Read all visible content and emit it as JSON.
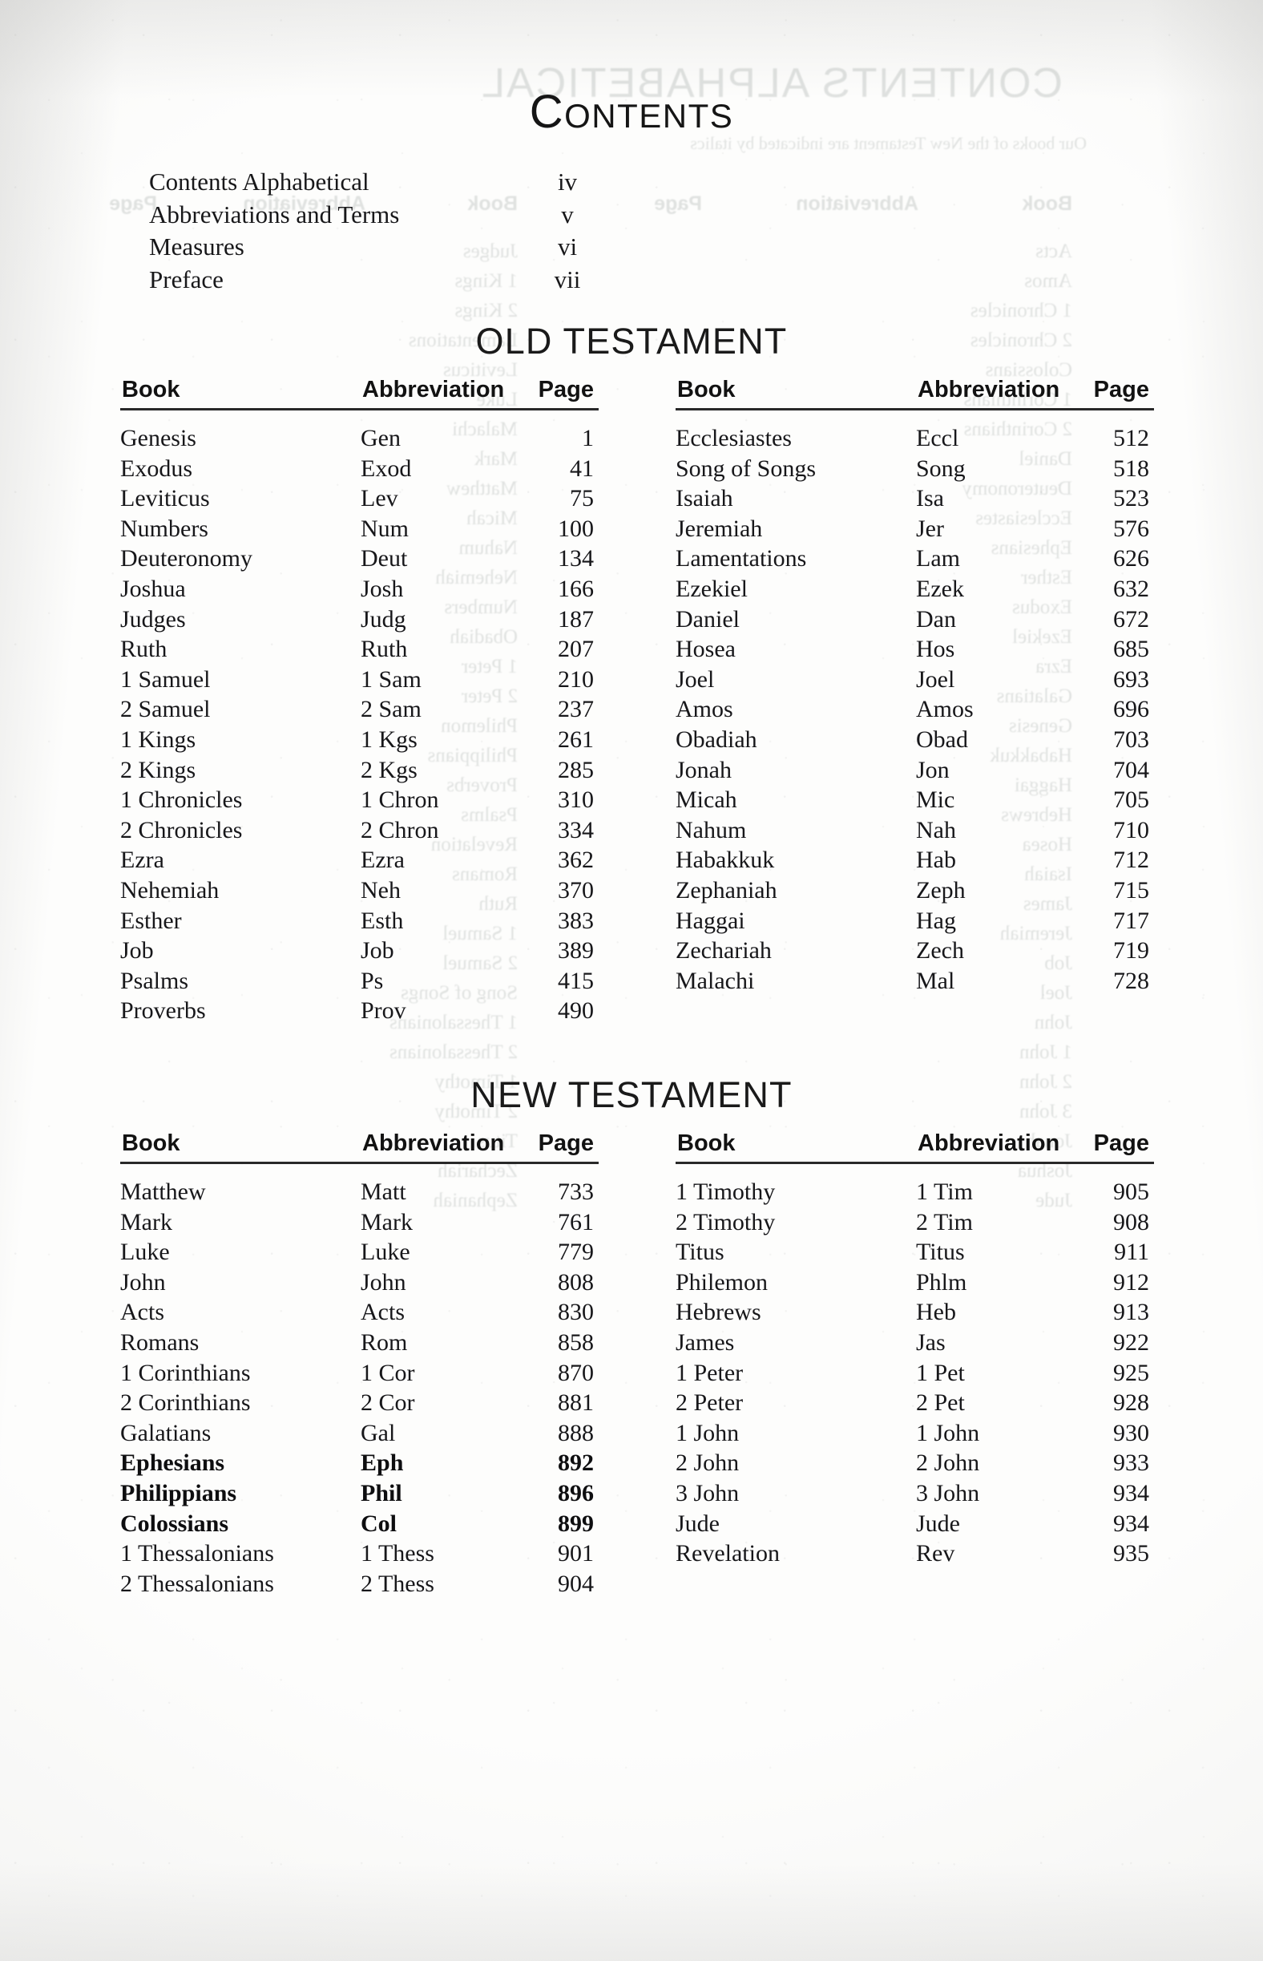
{
  "page": {
    "title": "Contents",
    "title_first_letter": "C",
    "title_rest": "ONTENTS"
  },
  "front_matter": {
    "rows": [
      {
        "label": "Contents Alphabetical",
        "page": "iv"
      },
      {
        "label": "Abbreviations and Terms",
        "page": "v"
      },
      {
        "label": "Measures",
        "page": "vi"
      },
      {
        "label": "Preface",
        "page": "vii"
      }
    ]
  },
  "old_testament": {
    "heading": "OLD TESTAMENT",
    "columns": {
      "book": "Book",
      "abbreviation": "Abbreviation",
      "page": "Page"
    },
    "left": [
      {
        "book": "Genesis",
        "abbr": "Gen",
        "page": "1"
      },
      {
        "book": "Exodus",
        "abbr": "Exod",
        "page": "41"
      },
      {
        "book": "Leviticus",
        "abbr": "Lev",
        "page": "75"
      },
      {
        "book": "Numbers",
        "abbr": "Num",
        "page": "100"
      },
      {
        "book": "Deuteronomy",
        "abbr": "Deut",
        "page": "134"
      },
      {
        "book": "Joshua",
        "abbr": "Josh",
        "page": "166"
      },
      {
        "book": "Judges",
        "abbr": "Judg",
        "page": "187"
      },
      {
        "book": "Ruth",
        "abbr": "Ruth",
        "page": "207"
      },
      {
        "book": "1 Samuel",
        "abbr": "1 Sam",
        "page": "210"
      },
      {
        "book": "2 Samuel",
        "abbr": "2 Sam",
        "page": "237"
      },
      {
        "book": "1 Kings",
        "abbr": "1 Kgs",
        "page": "261"
      },
      {
        "book": "2 Kings",
        "abbr": "2 Kgs",
        "page": "285"
      },
      {
        "book": "1 Chronicles",
        "abbr": "1 Chron",
        "page": "310"
      },
      {
        "book": "2 Chronicles",
        "abbr": "2 Chron",
        "page": "334"
      },
      {
        "book": "Ezra",
        "abbr": "Ezra",
        "page": "362"
      },
      {
        "book": "Nehemiah",
        "abbr": "Neh",
        "page": "370"
      },
      {
        "book": "Esther",
        "abbr": "Esth",
        "page": "383"
      },
      {
        "book": "Job",
        "abbr": "Job",
        "page": "389"
      },
      {
        "book": "Psalms",
        "abbr": "Ps",
        "page": "415"
      },
      {
        "book": "Proverbs",
        "abbr": "Prov",
        "page": "490"
      }
    ],
    "right": [
      {
        "book": "Ecclesiastes",
        "abbr": "Eccl",
        "page": "512"
      },
      {
        "book": "Song of Songs",
        "abbr": "Song",
        "page": "518"
      },
      {
        "book": "Isaiah",
        "abbr": "Isa",
        "page": "523"
      },
      {
        "book": "Jeremiah",
        "abbr": "Jer",
        "page": "576"
      },
      {
        "book": "Lamentations",
        "abbr": "Lam",
        "page": "626"
      },
      {
        "book": "Ezekiel",
        "abbr": "Ezek",
        "page": "632"
      },
      {
        "book": "Daniel",
        "abbr": "Dan",
        "page": "672"
      },
      {
        "book": "Hosea",
        "abbr": "Hos",
        "page": "685"
      },
      {
        "book": "Joel",
        "abbr": "Joel",
        "page": "693"
      },
      {
        "book": "Amos",
        "abbr": "Amos",
        "page": "696"
      },
      {
        "book": "Obadiah",
        "abbr": "Obad",
        "page": "703"
      },
      {
        "book": "Jonah",
        "abbr": "Jon",
        "page": "704"
      },
      {
        "book": "Micah",
        "abbr": "Mic",
        "page": "705"
      },
      {
        "book": "Nahum",
        "abbr": "Nah",
        "page": "710"
      },
      {
        "book": "Habakkuk",
        "abbr": "Hab",
        "page": "712"
      },
      {
        "book": "Zephaniah",
        "abbr": "Zeph",
        "page": "715"
      },
      {
        "book": "Haggai",
        "abbr": "Hag",
        "page": "717"
      },
      {
        "book": "Zechariah",
        "abbr": "Zech",
        "page": "719"
      },
      {
        "book": "Malachi",
        "abbr": "Mal",
        "page": "728"
      }
    ]
  },
  "new_testament": {
    "heading": "NEW TESTAMENT",
    "columns": {
      "book": "Book",
      "abbreviation": "Abbreviation",
      "page": "Page"
    },
    "left": [
      {
        "book": "Matthew",
        "abbr": "Matt",
        "page": "733"
      },
      {
        "book": "Mark",
        "abbr": "Mark",
        "page": "761"
      },
      {
        "book": "Luke",
        "abbr": "Luke",
        "page": "779"
      },
      {
        "book": "John",
        "abbr": "John",
        "page": "808"
      },
      {
        "book": "Acts",
        "abbr": "Acts",
        "page": "830"
      },
      {
        "book": "Romans",
        "abbr": "Rom",
        "page": "858"
      },
      {
        "book": "1 Corinthians",
        "abbr": "1 Cor",
        "page": "870"
      },
      {
        "book": "2 Corinthians",
        "abbr": "2 Cor",
        "page": "881"
      },
      {
        "book": "Galatians",
        "abbr": "Gal",
        "page": "888"
      },
      {
        "book": "Ephesians",
        "abbr": "Eph",
        "page": "892"
      },
      {
        "book": "Philippians",
        "abbr": "Phil",
        "page": "896"
      },
      {
        "book": "Colossians",
        "abbr": "Col",
        "page": "899"
      },
      {
        "book": "1 Thessalonians",
        "abbr": "1 Thess",
        "page": "901"
      },
      {
        "book": "2 Thessalonians",
        "abbr": "2 Thess",
        "page": "904"
      }
    ],
    "right": [
      {
        "book": "1 Timothy",
        "abbr": "1 Tim",
        "page": "905"
      },
      {
        "book": "2 Timothy",
        "abbr": "2 Tim",
        "page": "908"
      },
      {
        "book": "Titus",
        "abbr": "Titus",
        "page": "911"
      },
      {
        "book": "Philemon",
        "abbr": "Phlm",
        "page": "912"
      },
      {
        "book": "Hebrews",
        "abbr": "Heb",
        "page": "913"
      },
      {
        "book": "James",
        "abbr": "Jas",
        "page": "922"
      },
      {
        "book": "1 Peter",
        "abbr": "1 Pet",
        "page": "925"
      },
      {
        "book": "2 Peter",
        "abbr": "2 Pet",
        "page": "928"
      },
      {
        "book": "1 John",
        "abbr": "1 John",
        "page": "930"
      },
      {
        "book": "2 John",
        "abbr": "2 John",
        "page": "933"
      },
      {
        "book": "3 John",
        "abbr": "3 John",
        "page": "934"
      },
      {
        "book": "Jude",
        "abbr": "Jude",
        "page": "934"
      },
      {
        "book": "Revelation",
        "abbr": "Rev",
        "page": "935"
      }
    ]
  },
  "bleed_through": {
    "note": "mirrored show-through from the reverse leaf (Contents Alphabetical page)",
    "title": "CONTENTS ALPHABETICAL",
    "intro": "Our books of the New Testament are indicated by italics",
    "headings": [
      "Book",
      "Abbreviation",
      "Page"
    ],
    "rows": [
      "Acts",
      "Amos",
      "1 Chronicles",
      "2 Chronicles",
      "Colossians",
      "1 Corinthians",
      "2 Corinthians",
      "Daniel",
      "Deuteronomy",
      "Ecclesiastes",
      "Ephesians",
      "Esther",
      "Exodus",
      "Ezekiel",
      "Ezra",
      "Galatians",
      "Genesis",
      "Habakkuk",
      "Haggai",
      "Hebrews",
      "Hosea",
      "Isaiah",
      "James",
      "Jeremiah",
      "Job",
      "Joel",
      "John",
      "1 John",
      "2 John",
      "3 John",
      "Jonah",
      "Joshua",
      "Jude",
      "Judges",
      "1 Kings",
      "2 Kings",
      "Lamentations",
      "Leviticus",
      "Luke",
      "Malachi",
      "Mark",
      "Matthew",
      "Micah",
      "Nahum",
      "Nehemiah",
      "Numbers",
      "Obadiah",
      "1 Peter",
      "2 Peter",
      "Philemon",
      "Philippians",
      "Proverbs",
      "Psalms",
      "Revelation",
      "Romans",
      "Ruth",
      "1 Samuel",
      "2 Samuel",
      "Song of Songs",
      "1 Thessalonians",
      "2 Thessalonians",
      "1 Timothy",
      "2 Timothy",
      "Titus",
      "Zechariah",
      "Zephaniah"
    ]
  }
}
